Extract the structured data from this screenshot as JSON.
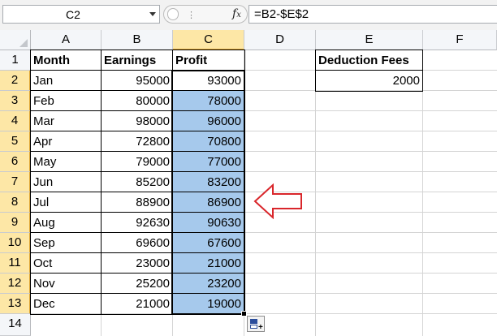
{
  "formula_bar": {
    "name_box": "C2",
    "formula": "=B2-$E$2"
  },
  "columns": [
    "A",
    "B",
    "C",
    "D",
    "E",
    "F"
  ],
  "rows": [
    "1",
    "2",
    "3",
    "4",
    "5",
    "6",
    "7",
    "8",
    "9",
    "10",
    "11",
    "12",
    "13",
    "14"
  ],
  "table": {
    "headers": [
      "Month",
      "Earnings",
      "Profit"
    ],
    "data": [
      [
        "Jan",
        "95000",
        "93000"
      ],
      [
        "Feb",
        "80000",
        "78000"
      ],
      [
        "Mar",
        "98000",
        "96000"
      ],
      [
        "Apr",
        "72800",
        "70800"
      ],
      [
        "May",
        "79000",
        "77000"
      ],
      [
        "Jun",
        "85200",
        "83200"
      ],
      [
        "Jul",
        "88900",
        "86900"
      ],
      [
        "Aug",
        "92630",
        "90630"
      ],
      [
        "Sep",
        "69600",
        "67600"
      ],
      [
        "Oct",
        "23000",
        "21000"
      ],
      [
        "Nov",
        "25200",
        "23200"
      ],
      [
        "Dec",
        "21000",
        "19000"
      ]
    ]
  },
  "deduction": {
    "header": "Deduction Fees",
    "value": "2000"
  },
  "selection": {
    "active_cell": "C2",
    "range": "C2:C13",
    "color": "#a6c9ec"
  },
  "icons": {
    "arrow": "red-left-arrow-icon",
    "autofill": "auto-fill-options-icon",
    "function": "fx-icon"
  },
  "colors": {
    "header_selected": "#fde7a6",
    "arrow_stroke": "#d9262b"
  }
}
